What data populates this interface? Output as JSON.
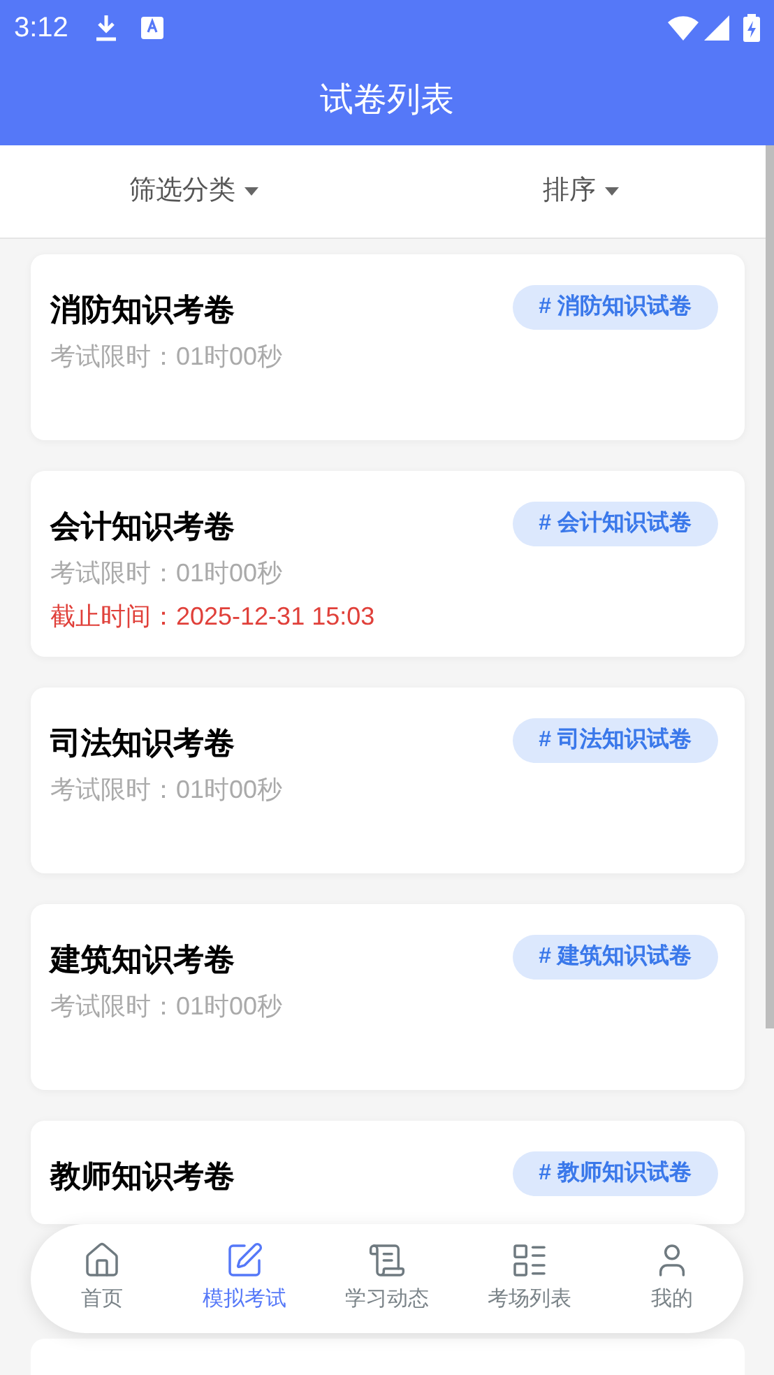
{
  "status_bar": {
    "time": "3:12"
  },
  "header": {
    "title": "试卷列表"
  },
  "filters": [
    {
      "label": "筛选分类"
    },
    {
      "label": "排序"
    }
  ],
  "papers": [
    {
      "title": "消防知识考卷",
      "tag": "# 消防知识试卷",
      "limit": "考试限时：01时00秒"
    },
    {
      "title": "会计知识考卷",
      "tag": "# 会计知识试卷",
      "limit": "考试限时：01时00秒",
      "deadline": "截止时间：2025-12-31 15:03"
    },
    {
      "title": "司法知识考卷",
      "tag": "# 司法知识试卷",
      "limit": "考试限时：01时00秒"
    },
    {
      "title": "建筑知识考卷",
      "tag": "# 建筑知识试卷",
      "limit": "考试限时：01时00秒"
    },
    {
      "title": "教师知识考卷",
      "tag": "# 教师知识试卷"
    }
  ],
  "bottom_nav": [
    {
      "label": "首页",
      "selected": false
    },
    {
      "label": "模拟考试",
      "selected": true
    },
    {
      "label": "学习动态",
      "selected": false
    },
    {
      "label": "考场列表",
      "selected": false
    },
    {
      "label": "我的",
      "selected": false
    }
  ]
}
